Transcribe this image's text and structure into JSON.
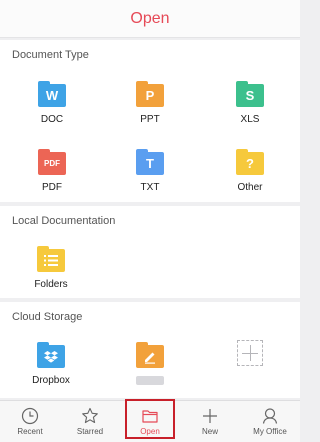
{
  "header": {
    "title": "Open"
  },
  "document_type": {
    "title": "Document Type",
    "items": [
      {
        "label": "DOC",
        "icon": "doc-icon",
        "glyph": "W",
        "color": "#3ea3e6"
      },
      {
        "label": "PPT",
        "icon": "ppt-icon",
        "glyph": "P",
        "color": "#f2a13b"
      },
      {
        "label": "XLS",
        "icon": "xls-icon",
        "glyph": "S",
        "color": "#3cc08d"
      },
      {
        "label": "PDF",
        "icon": "pdf-icon",
        "glyph": "PDF",
        "color": "#ec6555"
      },
      {
        "label": "TXT",
        "icon": "txt-icon",
        "glyph": "T",
        "color": "#5a9ef0"
      },
      {
        "label": "Other",
        "icon": "other-icon",
        "glyph": "?",
        "color": "#f6c93c"
      }
    ]
  },
  "local_documentation": {
    "title": "Local Documentation",
    "items": [
      {
        "label": "Folders",
        "icon": "folders-icon",
        "color": "#f6c93c"
      }
    ]
  },
  "cloud_storage": {
    "title": "Cloud Storage",
    "items": [
      {
        "label": "Dropbox",
        "icon": "dropbox-icon",
        "color": "#3ea3e6"
      },
      {
        "label": "",
        "icon": "edit-icon",
        "color": "#f2a13b"
      },
      {
        "label": "",
        "icon": "add-storage-icon"
      }
    ]
  },
  "tabbar": {
    "items": [
      {
        "label": "Recent",
        "icon": "clock-icon"
      },
      {
        "label": "Starred",
        "icon": "star-icon"
      },
      {
        "label": "Open",
        "icon": "folder-icon",
        "active": true
      },
      {
        "label": "New",
        "icon": "plus-icon"
      },
      {
        "label": "My Office",
        "icon": "user-icon"
      }
    ]
  },
  "colors": {
    "accent": "#e64a57",
    "highlight_border": "#c8202a"
  }
}
